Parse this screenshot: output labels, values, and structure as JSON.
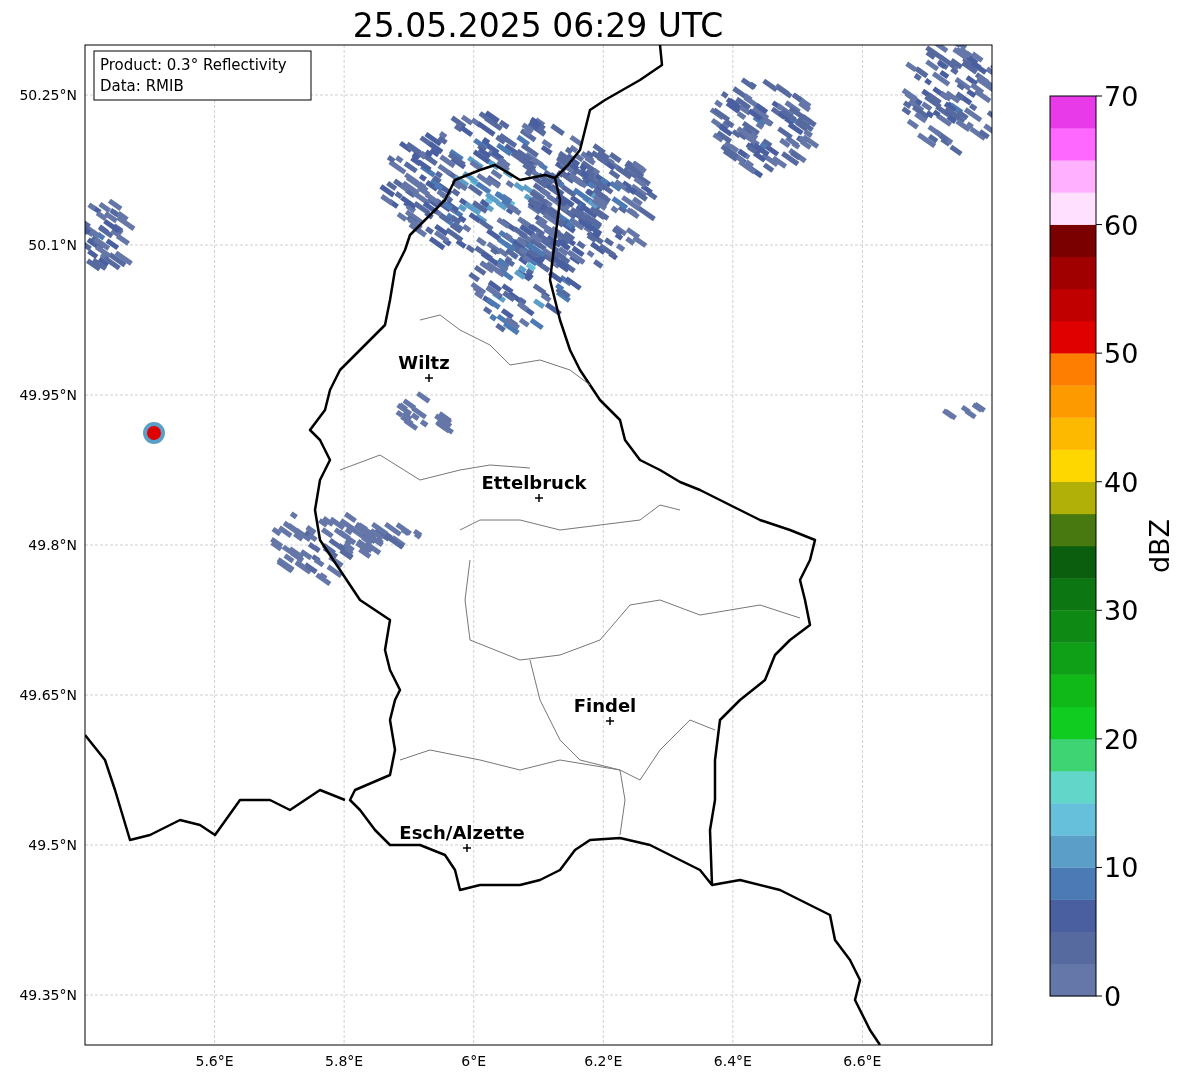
{
  "title": "25.05.2025 06:29 UTC",
  "info_box": [
    "Product: 0.3° Reflectivity",
    "Data: RMIB"
  ],
  "x_ticks": [
    "5.6°E",
    "5.8°E",
    "6°E",
    "6.2°E",
    "6.4°E",
    "6.6°E"
  ],
  "y_ticks": [
    "50.25°N",
    "50.1°N",
    "49.95°N",
    "49.8°N",
    "49.65°N",
    "49.5°N",
    "49.35°N"
  ],
  "cities": [
    {
      "name": "Wiltz"
    },
    {
      "name": "Ettelbruck"
    },
    {
      "name": "Findel"
    },
    {
      "name": "Esch/Alzette"
    }
  ],
  "colorbar": {
    "label": "dBZ",
    "ticks": [
      "70",
      "60",
      "50",
      "40",
      "30",
      "20",
      "10",
      "0"
    ],
    "bins": [
      {
        "color": "#6577a8"
      },
      {
        "color": "#566aa0"
      },
      {
        "color": "#4a5fa0"
      },
      {
        "color": "#4b7ab4"
      },
      {
        "color": "#5b9ec8"
      },
      {
        "color": "#66c0dc"
      },
      {
        "color": "#62d6c8"
      },
      {
        "color": "#3ed474"
      },
      {
        "color": "#10cc20"
      },
      {
        "color": "#10b818"
      },
      {
        "color": "#10a018"
      },
      {
        "color": "#0e8a14"
      },
      {
        "color": "#0c7612"
      },
      {
        "color": "#0a5e0e"
      },
      {
        "color": "#487810"
      },
      {
        "color": "#b0b008"
      },
      {
        "color": "#fed700"
      },
      {
        "color": "#fdb800"
      },
      {
        "color": "#fd9a00"
      },
      {
        "color": "#fd7e00"
      },
      {
        "color": "#e00000"
      },
      {
        "color": "#c00000"
      },
      {
        "color": "#a00000"
      },
      {
        "color": "#7a0000"
      },
      {
        "color": "#ffe0ff"
      },
      {
        "color": "#ffb0ff"
      },
      {
        "color": "#ff68ff"
      },
      {
        "color": "#e83ae8"
      }
    ]
  }
}
